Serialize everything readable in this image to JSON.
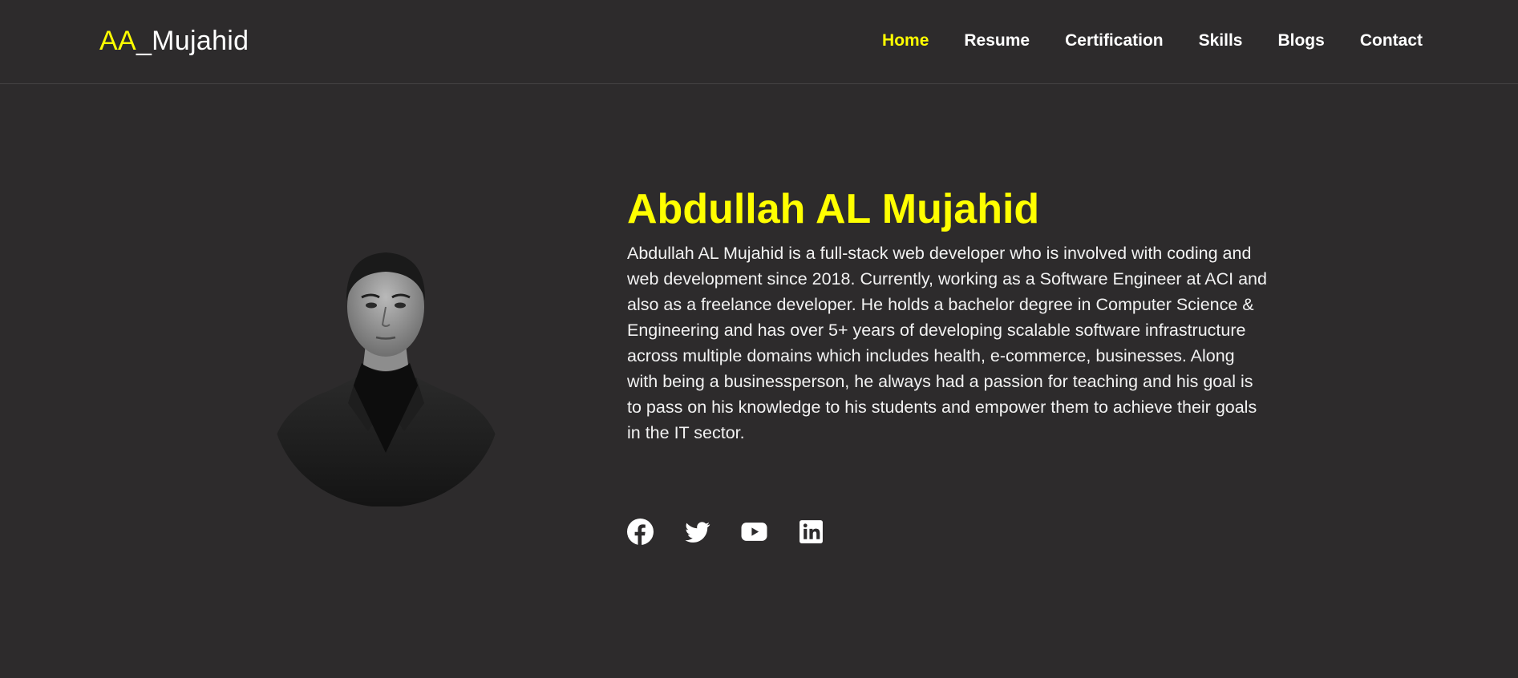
{
  "header": {
    "logo_accent": "AA",
    "logo_rest": "_Mujahid",
    "nav": [
      {
        "label": "Home",
        "active": true
      },
      {
        "label": "Resume"
      },
      {
        "label": "Certification"
      },
      {
        "label": "Skills"
      },
      {
        "label": "Blogs"
      },
      {
        "label": "Contact"
      }
    ]
  },
  "hero": {
    "name": "Abdullah AL Mujahid",
    "bio": "Abdullah AL Mujahid is a full-stack web developer who is involved with coding and web development since 2018. Currently, working as a Software Engineer at ACI and also as a freelance developer. He holds a bachelor degree in Computer Science & Engineering and has over 5+ years of developing scalable software infrastructure across multiple domains which includes health, e-commerce, businesses. Along with being a businessperson, he always had a passion for teaching and his goal is to pass on his knowledge to his students and empower them to achieve their goals in the IT sector.",
    "photo": "profile-photo-grayscale-portrait"
  },
  "social": [
    {
      "name": "facebook-icon"
    },
    {
      "name": "twitter-icon"
    },
    {
      "name": "youtube-icon"
    },
    {
      "name": "linkedin-icon"
    }
  ],
  "colors": {
    "background": "#2d2b2c",
    "accent": "#ffff00",
    "text": "#ffffff"
  }
}
